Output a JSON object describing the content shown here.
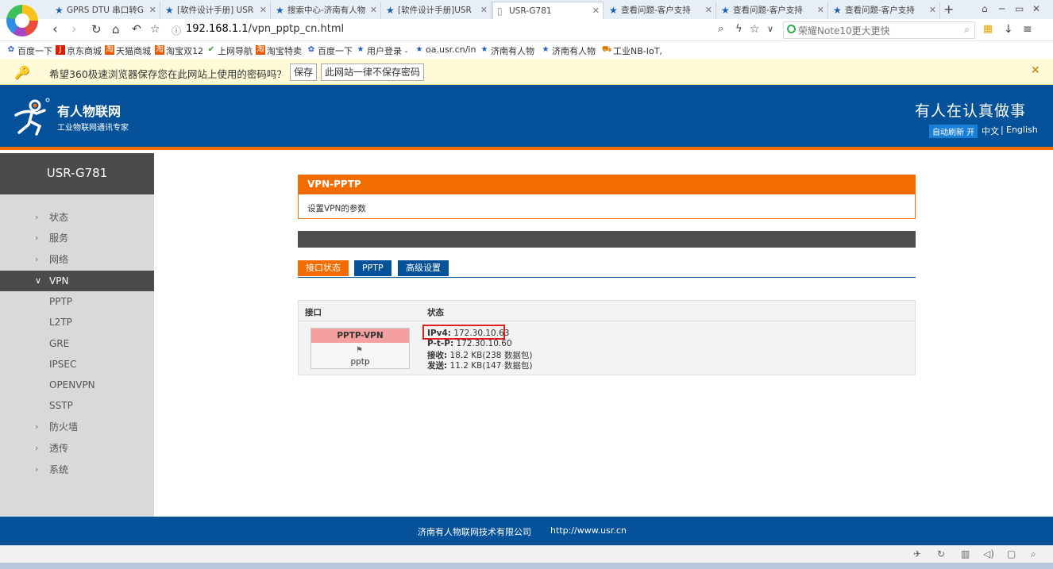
{
  "browser": {
    "tabs": [
      {
        "title": "GPRS DTU 串口转G",
        "active": false
      },
      {
        "title": "[软件设计手册] USR",
        "active": false
      },
      {
        "title": "搜索中心-济南有人物",
        "active": false
      },
      {
        "title": "[软件设计手册]USR",
        "active": false
      },
      {
        "title": "USR-G781",
        "active": true
      },
      {
        "title": "查看问题-客户支持",
        "active": false
      },
      {
        "title": "查看问题-客户支持",
        "active": false
      },
      {
        "title": "查看问题-客户支持",
        "active": false
      }
    ],
    "url_host": "192.168.1.1",
    "url_path": "/vpn_pptp_cn.html",
    "search_placeholder": "荣耀Note10更大更快",
    "bookmarks": [
      "百度一下",
      "京东商城",
      "天猫商城",
      "淘宝双12",
      "上网导航",
      "淘宝特卖",
      "百度一下",
      "用户登录 -",
      "oa.usr.cn/in",
      "济南有人物",
      "济南有人物",
      "工业NB-IoT,"
    ],
    "password_prompt": {
      "text": "希望360极速浏览器保存您在此网站上使用的密码吗？",
      "save_label": "保存",
      "never_label": "此网站一律不保存密码"
    }
  },
  "header": {
    "brand": "有人物联网",
    "tagline": "工业物联网通讯专家",
    "slogan": "有人在认真做事",
    "auto_refresh": "自动刷新 开",
    "lang_zh": "中文",
    "lang_sep": "|",
    "lang_en": "English"
  },
  "sidebar": {
    "device": "USR-G781",
    "menu": [
      "状态",
      "服务",
      "网络",
      "VPN"
    ],
    "vpn_sub": [
      "PPTP",
      "L2TP",
      "GRE",
      "IPSEC",
      "OPENVPN",
      "SSTP"
    ],
    "menu_after": [
      "防火墙",
      "透传",
      "系统"
    ]
  },
  "main": {
    "section_title": "VPN-PPTP",
    "section_desc": "设置VPN的参数",
    "tabs": [
      "接口状态",
      "PPTP",
      "高级设置"
    ],
    "table": {
      "col_iface": "接口",
      "col_status": "状态",
      "iface_name": "PPTP-VPN",
      "iface_label": "pptp",
      "ipv4_label": "IPv4:",
      "ipv4_value": "172.30.10.63",
      "ptp_label": "P-t-P:",
      "ptp_value": "172.30.10.60",
      "rx_label": "接收:",
      "rx_value": "18.2 KB(238 数据包)",
      "tx_label": "发送:",
      "tx_value": "11.2 KB(147 数据包)"
    }
  },
  "footer": {
    "company": "济南有人物联网技术有限公司",
    "url": "http://www.usr.cn"
  },
  "colors": {
    "brand_blue": "#06529a",
    "accent_orange": "#f26c00",
    "sidebar_grey": "#d9d9d9",
    "sidebar_dark": "#4b4b4b",
    "highlight_red": "#e02020"
  }
}
